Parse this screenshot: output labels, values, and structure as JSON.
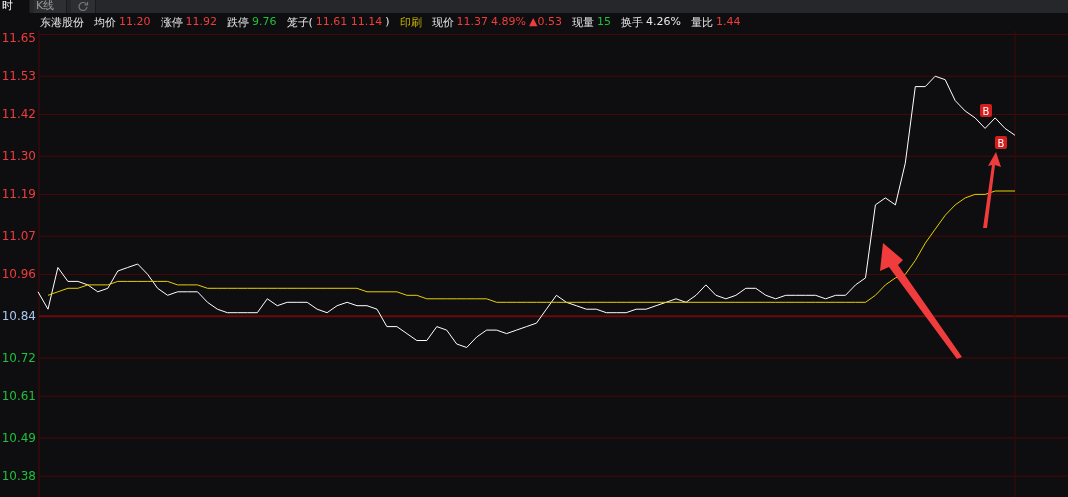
{
  "tabs": [
    {
      "label": "时",
      "kind": "text",
      "selected": true
    },
    {
      "label": "K线",
      "kind": "text",
      "selected": false
    },
    {
      "kind": "icon",
      "selected": false
    }
  ],
  "quote": [
    {
      "parts": [
        {
          "text": "东港股份",
          "kind": "label"
        }
      ]
    },
    {
      "parts": [
        {
          "text": "均价",
          "kind": "label"
        },
        {
          "text": "11.20",
          "kind": "up"
        }
      ]
    },
    {
      "parts": [
        {
          "text": "涨停",
          "kind": "label"
        },
        {
          "text": "11.92",
          "kind": "up"
        }
      ]
    },
    {
      "parts": [
        {
          "text": "跌停",
          "kind": "label"
        },
        {
          "text": "9.76",
          "kind": "down"
        }
      ]
    },
    {
      "parts": [
        {
          "text": "笼子(",
          "kind": "label"
        },
        {
          "text": "11.61 11.14",
          "kind": "up"
        },
        {
          "text": ")",
          "kind": "label"
        }
      ]
    },
    {
      "parts": [
        {
          "text": "印刷",
          "kind": "sector"
        }
      ]
    },
    {
      "parts": [
        {
          "text": "现价",
          "kind": "label"
        },
        {
          "text": "11.37",
          "kind": "up"
        },
        {
          "text": "4.89%",
          "kind": "up"
        },
        {
          "text": "▲0.53",
          "kind": "up"
        }
      ]
    },
    {
      "parts": [
        {
          "text": "现量",
          "kind": "label"
        },
        {
          "text": "15",
          "kind": "down"
        }
      ]
    },
    {
      "parts": [
        {
          "text": "换手",
          "kind": "label"
        },
        {
          "text": "4.26%",
          "kind": "label"
        }
      ]
    },
    {
      "parts": [
        {
          "text": "量比",
          "kind": "label"
        },
        {
          "text": "1.44",
          "kind": "up"
        }
      ]
    }
  ],
  "chart_data": {
    "type": "line",
    "grid": true,
    "ylim": [
      10.32,
      11.66
    ],
    "series": [
      {
        "color": "#ffffff",
        "values": [
          10.91,
          10.86,
          10.98,
          10.94,
          10.94,
          10.93,
          10.91,
          10.92,
          10.97,
          10.98,
          10.99,
          10.96,
          10.92,
          10.9,
          10.91,
          10.91,
          10.91,
          10.88,
          10.86,
          10.85,
          10.85,
          10.85,
          10.85,
          10.89,
          10.87,
          10.88,
          10.88,
          10.88,
          10.86,
          10.85,
          10.87,
          10.88,
          10.87,
          10.87,
          10.86,
          10.81,
          10.81,
          10.79,
          10.77,
          10.77,
          10.81,
          10.8,
          10.76,
          10.75,
          10.78,
          10.8,
          10.8,
          10.79,
          10.8,
          10.81,
          10.82,
          10.86,
          10.9,
          10.88,
          10.87,
          10.86,
          10.86,
          10.85,
          10.85,
          10.85,
          10.86,
          10.86,
          10.87,
          10.88,
          10.89,
          10.88,
          10.9,
          10.93,
          10.9,
          10.89,
          10.9,
          10.92,
          10.92,
          10.9,
          10.89,
          10.9,
          10.9,
          10.9,
          10.9,
          10.89,
          10.9,
          10.9,
          10.93,
          10.95,
          11.16,
          11.18,
          11.16,
          11.28,
          11.5,
          11.5,
          11.53,
          11.52,
          11.46,
          11.43,
          11.41,
          11.38,
          11.41,
          11.38,
          11.36
        ]
      },
      {
        "color": "#e8d000",
        "values": [
          null,
          10.9,
          10.91,
          10.92,
          10.92,
          10.93,
          10.93,
          10.93,
          10.94,
          10.94,
          10.94,
          10.94,
          10.94,
          10.94,
          10.93,
          10.93,
          10.93,
          10.92,
          10.92,
          10.92,
          10.92,
          10.92,
          10.92,
          10.92,
          10.92,
          10.92,
          10.92,
          10.92,
          10.92,
          10.92,
          10.92,
          10.92,
          10.92,
          10.91,
          10.91,
          10.91,
          10.91,
          10.9,
          10.9,
          10.89,
          10.89,
          10.89,
          10.89,
          10.89,
          10.89,
          10.89,
          10.88,
          10.88,
          10.88,
          10.88,
          10.88,
          10.88,
          10.88,
          10.88,
          10.88,
          10.88,
          10.88,
          10.88,
          10.88,
          10.88,
          10.88,
          10.88,
          10.88,
          10.88,
          10.88,
          10.88,
          10.88,
          10.88,
          10.88,
          10.88,
          10.88,
          10.88,
          10.88,
          10.88,
          10.88,
          10.88,
          10.88,
          10.88,
          10.88,
          10.88,
          10.88,
          10.88,
          10.88,
          10.88,
          10.9,
          10.93,
          10.95,
          10.96,
          11.0,
          11.05,
          11.09,
          11.13,
          11.16,
          11.18,
          11.19,
          11.19,
          11.2,
          11.2,
          11.2
        ]
      }
    ],
    "yticks": [
      {
        "value": 11.65,
        "label": "11.65"
      },
      {
        "value": 11.53,
        "label": "11.53"
      },
      {
        "value": 11.42,
        "label": "11.42"
      },
      {
        "value": 11.3,
        "label": "11.30"
      },
      {
        "value": 11.19,
        "label": "11.19"
      },
      {
        "value": 11.07,
        "label": "11.07"
      },
      {
        "value": 10.96,
        "label": "10.96"
      },
      {
        "value": 10.84,
        "label": "10.84"
      },
      {
        "value": 10.72,
        "label": "10.72"
      },
      {
        "value": 10.61,
        "label": "10.61"
      },
      {
        "value": 10.49,
        "label": "10.49"
      },
      {
        "value": 10.38,
        "label": "10.38"
      }
    ],
    "ref_lines": [
      {
        "axis": "y",
        "value": 10.84
      }
    ],
    "annotations": [
      "B",
      "B"
    ]
  }
}
